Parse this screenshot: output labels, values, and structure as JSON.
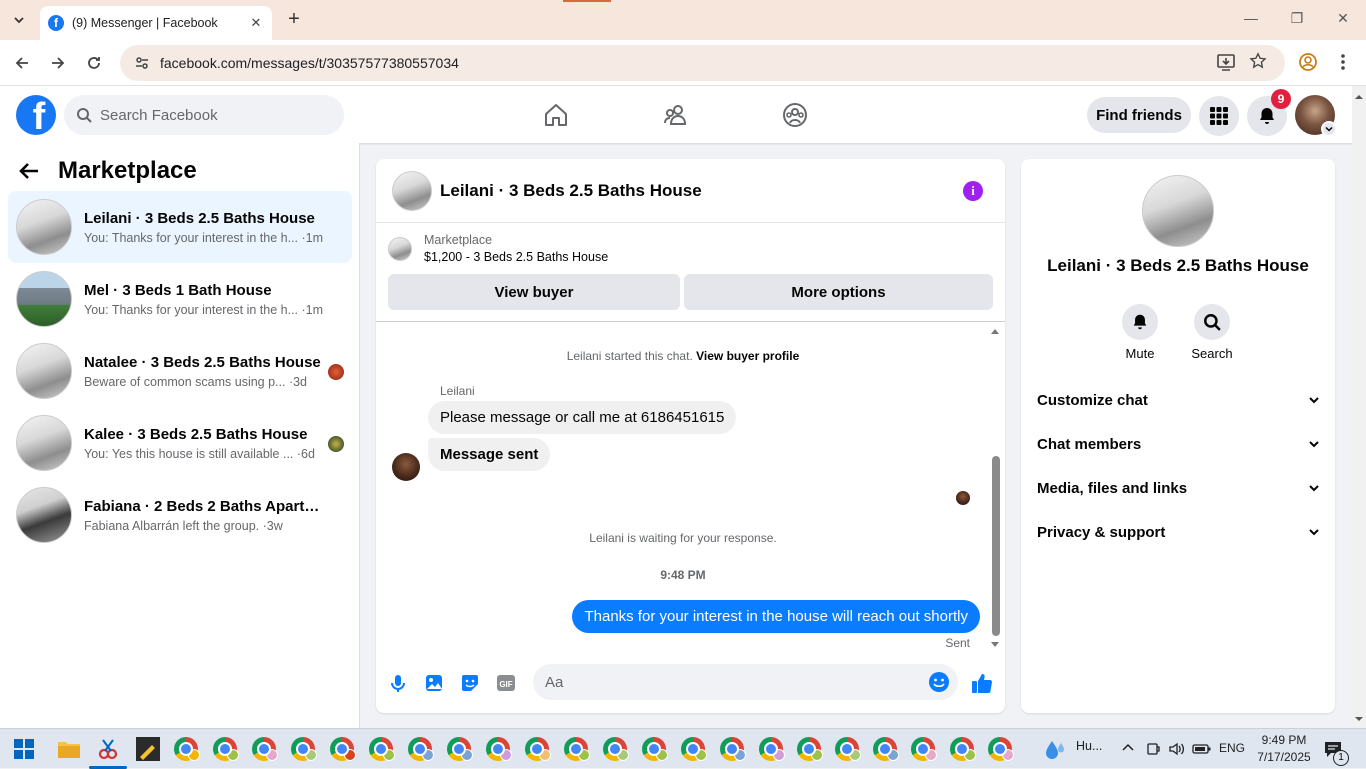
{
  "browser": {
    "tab_title": "(9) Messenger | Facebook",
    "tab_favicon": "f",
    "url": "facebook.com/messages/t/30357577380557034"
  },
  "fb_header": {
    "search_placeholder": "Search Facebook",
    "find_friends_label": "Find friends",
    "notification_count": "9"
  },
  "left_panel": {
    "title": "Marketplace",
    "chats": [
      {
        "name": "Leilani · 3 Beds 2.5 Baths House",
        "snippet": "You: Thanks for your interest in the h... ·1m",
        "active": true
      },
      {
        "name": "Mel · 3 Beds 1 Bath House",
        "snippet": "You: Thanks for your interest in the h... ·1m",
        "active": false
      },
      {
        "name": "Natalee · 3 Beds 2.5 Baths House",
        "snippet": "Beware of common scams using p... ·3d",
        "active": false
      },
      {
        "name": "Kalee · 3 Beds 2.5 Baths House",
        "snippet": "You: Yes this house is still available ... ·6d",
        "active": false
      },
      {
        "name": "Fabiana · 2 Beds 2 Baths Apartmen...",
        "snippet": "Fabiana Albarrán left the group. ·3w",
        "active": false
      }
    ]
  },
  "conversation": {
    "title": "Leilani · 3 Beds 2.5 Baths House",
    "listing_label": "Marketplace",
    "listing_price": "$1,200 - 3 Beds 2.5 Baths House",
    "view_buyer_label": "View buyer",
    "more_options_label": "More options",
    "started_text": "Leilani started this chat.",
    "view_buyer_profile_label": "View buyer profile",
    "sender_name": "Leilani",
    "incoming_messages": [
      "Please message or call me at 6186451615",
      "Message sent"
    ],
    "waiting_text": "Leilani is waiting for your response.",
    "timestamp": "9:48 PM",
    "outgoing_message": "Thanks for your interest in the house will reach out shortly",
    "sent_status": "Sent",
    "composer_placeholder": "Aa",
    "accent_color": "#0a7cff"
  },
  "right_panel": {
    "name": "Leilani · 3 Beds 2.5 Baths House",
    "mute_label": "Mute",
    "search_label": "Search",
    "sections": [
      "Customize chat",
      "Chat members",
      "Media, files and links",
      "Privacy & support"
    ]
  },
  "taskbar": {
    "weather_label": "Hu...",
    "language": "ENG",
    "time": "9:49 PM",
    "date": "7/17/2025",
    "notification_count": "1"
  }
}
